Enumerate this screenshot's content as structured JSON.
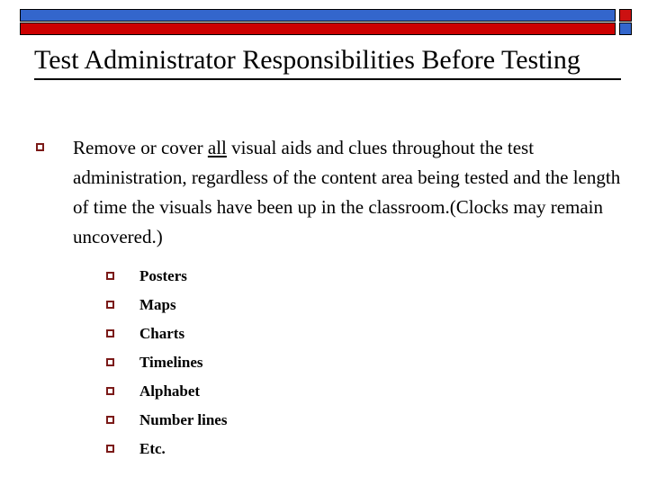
{
  "slide": {
    "title": "Test Administrator Responsibilities Before Testing",
    "background_color": "#FFFFFF"
  },
  "header_decoration": {
    "top_bar": {
      "name": "blue-bar",
      "color": "#3366CC",
      "accent_square_color": "#CC1111",
      "border_color": "#000000"
    },
    "bottom_bar": {
      "name": "red-bar",
      "color": "#CC0000",
      "accent_square_color": "#3366CC",
      "border_color": "#000000"
    }
  },
  "body": {
    "bullet_marker_color": "#7B1A18",
    "main_bullet": {
      "text_before": "Remove or cover ",
      "emphasis": "all",
      "text_after": " visual aids and clues throughout the test administration, regardless of the content area being tested and the length of time the visuals have been up in the classroom.(Clocks may remain uncovered.)",
      "full_text": "Remove or cover all visual aids and clues throughout the test administration, regardless of the content area being tested and the length of time the visuals have been up in the classroom.(Clocks may remain uncovered.)"
    },
    "sub_bullets": [
      {
        "label": "Posters"
      },
      {
        "label": "Maps"
      },
      {
        "label": "Charts"
      },
      {
        "label": "Timelines"
      },
      {
        "label": "Alphabet"
      },
      {
        "label": "Number lines"
      },
      {
        "label": "Etc."
      }
    ]
  }
}
